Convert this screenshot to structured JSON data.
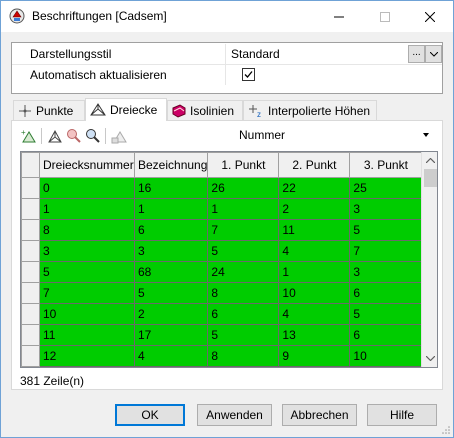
{
  "window": {
    "title": "Beschriftungen [Cadsem]"
  },
  "properties": {
    "rows": [
      {
        "label": "Darstellungsstil",
        "value": "Standard",
        "more": "..."
      },
      {
        "label": "Automatisch aktualisieren",
        "checked": true
      }
    ]
  },
  "tabs": [
    {
      "label": "Punkte",
      "icon": "point-icon"
    },
    {
      "label": "Dreiecke",
      "icon": "triangle-mesh-icon",
      "active": true
    },
    {
      "label": "Isolinien",
      "icon": "isolines-icon"
    },
    {
      "label": "Interpolierte Höhen",
      "icon": "interpolated-height-icon"
    }
  ],
  "toolbar": {
    "tools": [
      "add-label-icon",
      "triangle-pick-icon",
      "zoom-icon",
      "zoom-select-icon",
      "label-icon"
    ],
    "field_selected": "Nummer"
  },
  "grid": {
    "columns": [
      "Dreiecksnummer",
      "Bezeichnung",
      "1. Punkt",
      "2. Punkt",
      "3. Punkt"
    ],
    "rows": [
      [
        "0",
        "16",
        "26",
        "22",
        "25"
      ],
      [
        "1",
        "1",
        "1",
        "2",
        "3"
      ],
      [
        "8",
        "6",
        "7",
        "11",
        "5"
      ],
      [
        "3",
        "3",
        "5",
        "4",
        "7"
      ],
      [
        "5",
        "68",
        "24",
        "1",
        "3"
      ],
      [
        "7",
        "5",
        "8",
        "10",
        "6"
      ],
      [
        "10",
        "2",
        "6",
        "4",
        "5"
      ],
      [
        "11",
        "17",
        "5",
        "13",
        "6"
      ],
      [
        "12",
        "4",
        "8",
        "9",
        "10"
      ]
    ],
    "cell_color": "#00cc00"
  },
  "status": {
    "rowcount": "381 Zeile(n)"
  },
  "buttons": {
    "ok": "OK",
    "apply": "Anwenden",
    "cancel": "Abbrechen",
    "help": "Hilfe"
  }
}
